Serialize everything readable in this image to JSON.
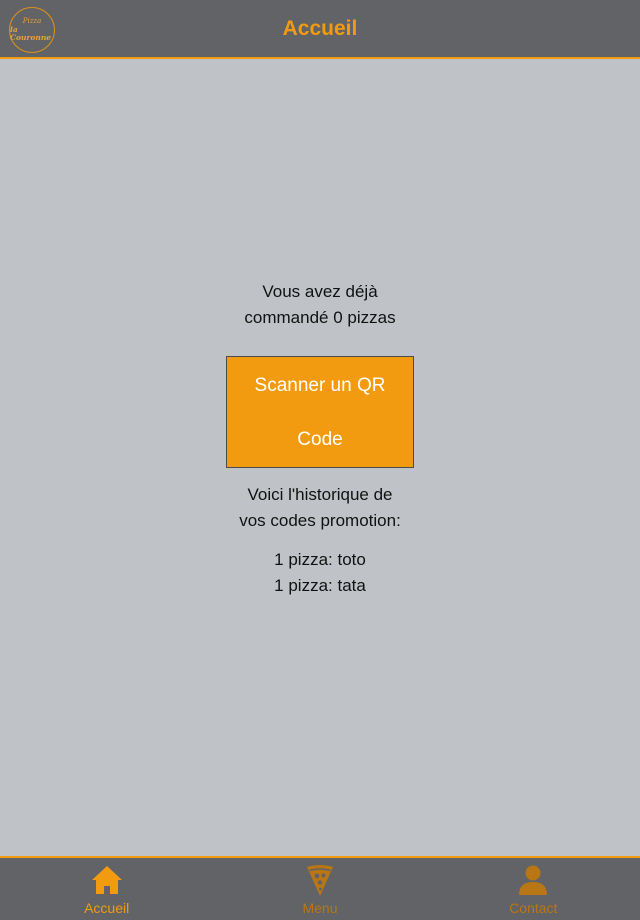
{
  "header": {
    "logo_text_line1": "Pizza",
    "logo_text_line2": "la Couronne",
    "title": "Accueil"
  },
  "main": {
    "count_line1": "Vous avez déjà",
    "count_line2": "commandé 0 pizzas",
    "scan_button_line1": "Scanner un QR",
    "scan_button_line2": "Code",
    "history_line1": "Voici l'historique de",
    "history_line2": "vos codes promotion:",
    "history_items": [
      "1 pizza: toto",
      "1 pizza: tata"
    ]
  },
  "tabbar": {
    "tabs": [
      {
        "label": "Accueil",
        "icon": "home-icon",
        "active": true
      },
      {
        "label": "Menu",
        "icon": "pizza-slice-icon",
        "active": false
      },
      {
        "label": "Contact",
        "icon": "person-icon",
        "active": false
      }
    ]
  },
  "colors": {
    "accent": "#f29b11",
    "bar_background": "#626366",
    "page_background": "#bfc3c7",
    "inactive_tab": "#b87614"
  }
}
